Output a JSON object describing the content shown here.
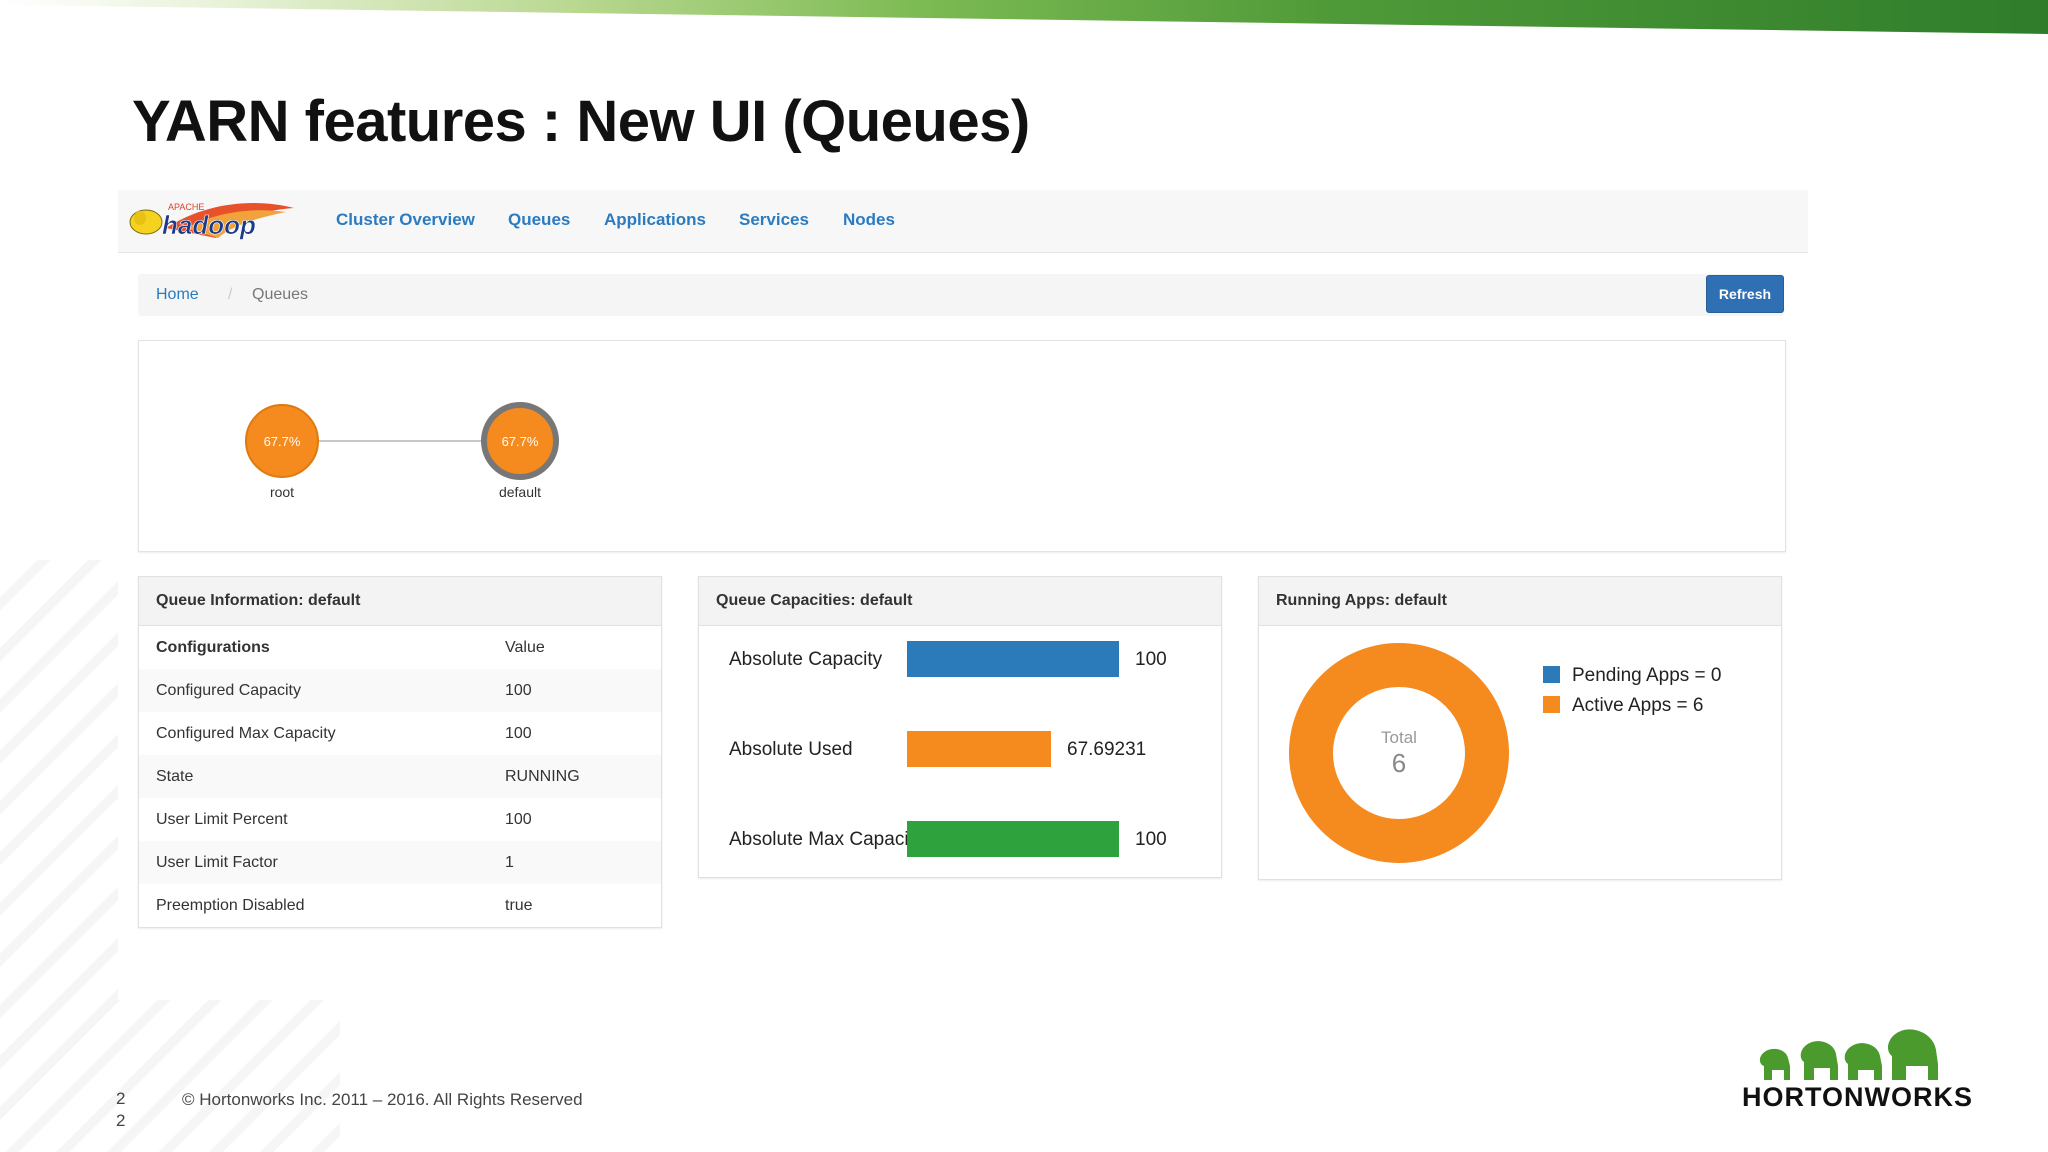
{
  "slide": {
    "title": "YARN features : New UI (Queues)",
    "page_number": "22",
    "copyright": "© Hortonworks Inc. 2011 – 2016. All Rights Reserved",
    "brand": "HORTONWORKS"
  },
  "app": {
    "logo_text": "hadoop",
    "logo_sub": "APACHE",
    "nav": [
      "Cluster Overview",
      "Queues",
      "Applications",
      "Services",
      "Nodes"
    ],
    "breadcrumb": {
      "home": "Home",
      "separator": "/",
      "current": "Queues"
    },
    "refresh_label": "Refresh"
  },
  "queue_tree": {
    "nodes": [
      {
        "label": "root",
        "percent_label": "67.7%",
        "selected": false
      },
      {
        "label": "default",
        "percent_label": "67.7%",
        "selected": true
      }
    ],
    "node_color": "#f58a1f"
  },
  "queue_info": {
    "title": "Queue Information: default",
    "header": {
      "key": "Configurations",
      "value": "Value"
    },
    "rows": [
      {
        "key": "Configured Capacity",
        "value": "100"
      },
      {
        "key": "Configured Max Capacity",
        "value": "100"
      },
      {
        "key": "State",
        "value": "RUNNING"
      },
      {
        "key": "User Limit Percent",
        "value": "100"
      },
      {
        "key": "User Limit Factor",
        "value": "1"
      },
      {
        "key": "Preemption Disabled",
        "value": "true"
      }
    ]
  },
  "queue_capacities": {
    "title": "Queue Capacities: default",
    "max": 100,
    "bars": [
      {
        "label": "Absolute Capacity",
        "value": 100,
        "value_label": "100",
        "color": "#2b7bba"
      },
      {
        "label": "Absolute Used",
        "value": 67.69231,
        "value_label": "67.69231",
        "color": "#f58a1f"
      },
      {
        "label": "Absolute Max Capaci",
        "value": 100,
        "value_label": "100",
        "color": "#2ea23c"
      }
    ]
  },
  "running_apps": {
    "title": "Running Apps: default",
    "total_label": "Total",
    "total": "6",
    "legend": [
      {
        "label": "Pending Apps = 0",
        "value": 0,
        "color": "#2b7bba"
      },
      {
        "label": "Active Apps = 6",
        "value": 6,
        "color": "#f58a1f"
      }
    ]
  }
}
